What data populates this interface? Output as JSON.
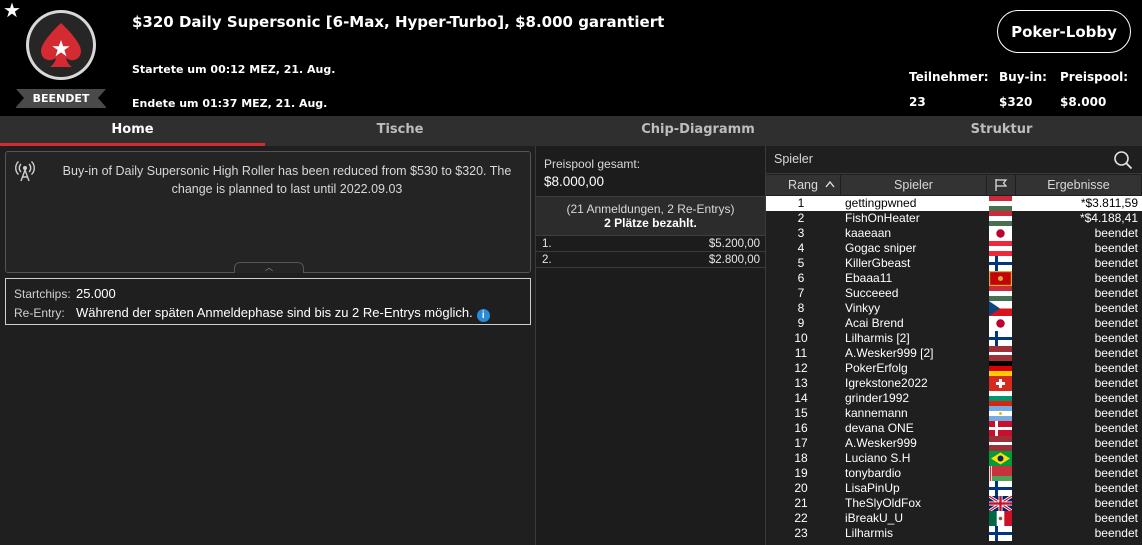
{
  "header": {
    "title": "$320 Daily Supersonic [6-Max, Hyper-Turbo], $8.000 garantiert",
    "started": "Startete um 00:12 MEZ, 21. Aug.",
    "ended": "Endete um 01:37 MEZ, 21. Aug.",
    "status": "BEENDET",
    "lobby_button": "Poker-Lobby",
    "stats": {
      "participants_label": "Teilnehmer:",
      "participants_value": "23",
      "buyin_label": "Buy-in:",
      "buyin_value": "$320",
      "prizepool_label": "Preispool:",
      "prizepool_value": "$8.000"
    }
  },
  "tabs": [
    "Home",
    "Tische",
    "Chip-Diagramm",
    "Struktur"
  ],
  "notice": {
    "text": "Buy-in of Daily Supersonic High Roller has been reduced from $530 to $320. The change is planned to last until 2022.09.03"
  },
  "info": {
    "startchips_label": "Startchips:",
    "startchips_value": "25.000",
    "reentry_label": "Re-Entry:",
    "reentry_value": "Während der späten Anmeldephase sind bis zu 2 Re-Entrys möglich.",
    "info_icon": "i"
  },
  "prizepool": {
    "label": "Preispool gesamt:",
    "value": "$8.000,00",
    "entries": "(21 Anmeldungen, 2 Re-Entrys)",
    "paid": "2 Plätze bezahlt.",
    "payouts": [
      {
        "pos": "1.",
        "amount": "$5.200,00"
      },
      {
        "pos": "2.",
        "amount": "$2.800,00"
      }
    ]
  },
  "players_panel": {
    "search_label": "Spieler",
    "columns": {
      "rank": "Rang",
      "player": "Spieler",
      "result": "Ergebnisse"
    },
    "rows": [
      {
        "rank": "1",
        "name": "gettingpwned",
        "flag": "hungary",
        "result": "*$3.811,59"
      },
      {
        "rank": "2",
        "name": "FishOnHeater",
        "flag": "hungary",
        "result": "*$4.188,41"
      },
      {
        "rank": "3",
        "name": "kaaeaan",
        "flag": "japan",
        "result": "beendet"
      },
      {
        "rank": "4",
        "name": "Gogac sniper",
        "flag": "austria",
        "result": "beendet"
      },
      {
        "rank": "5",
        "name": "KillerGbeast",
        "flag": "finland",
        "result": "beendet"
      },
      {
        "rank": "6",
        "name": "Ebaaa11",
        "flag": "montenegro",
        "result": "beendet"
      },
      {
        "rank": "7",
        "name": "Succeeed",
        "flag": "hungary",
        "result": "beendet"
      },
      {
        "rank": "8",
        "name": "Vinkyy",
        "flag": "czechia",
        "result": "beendet"
      },
      {
        "rank": "9",
        "name": "Acai Brend",
        "flag": "japan",
        "result": "beendet"
      },
      {
        "rank": "10",
        "name": "Lilharmis [2]",
        "flag": "finland",
        "result": "beendet"
      },
      {
        "rank": "11",
        "name": "A.Wesker999 [2]",
        "flag": "latvia",
        "result": "beendet"
      },
      {
        "rank": "12",
        "name": "PokerErfolg",
        "flag": "germany",
        "result": "beendet"
      },
      {
        "rank": "13",
        "name": "Igrekstone2022",
        "flag": "switzerland",
        "result": "beendet"
      },
      {
        "rank": "14",
        "name": "grinder1992",
        "flag": "bulgaria",
        "result": "beendet"
      },
      {
        "rank": "15",
        "name": "kannemann",
        "flag": "argentina",
        "result": "beendet"
      },
      {
        "rank": "16",
        "name": "devana ONE",
        "flag": "denmark",
        "result": "beendet"
      },
      {
        "rank": "17",
        "name": "A.Wesker999",
        "flag": "latvia",
        "result": "beendet"
      },
      {
        "rank": "18",
        "name": "Luciano S.H",
        "flag": "brazil",
        "result": "beendet"
      },
      {
        "rank": "19",
        "name": "tonybardio",
        "flag": "belarus",
        "result": "beendet"
      },
      {
        "rank": "20",
        "name": "LisaPinUp",
        "flag": "finland",
        "result": "beendet"
      },
      {
        "rank": "21",
        "name": "TheSlyOldFox",
        "flag": "uk",
        "result": "beendet"
      },
      {
        "rank": "22",
        "name": "iBreakU_U",
        "flag": "mexico",
        "result": "beendet"
      },
      {
        "rank": "23",
        "name": "Lilharmis",
        "flag": "finland",
        "result": "beendet"
      }
    ]
  },
  "colors": {
    "accent_red": "#d42a31",
    "header_bg": "#000000",
    "panel_bg": "#1f1f1f",
    "info_blue": "#2a8bd6"
  }
}
